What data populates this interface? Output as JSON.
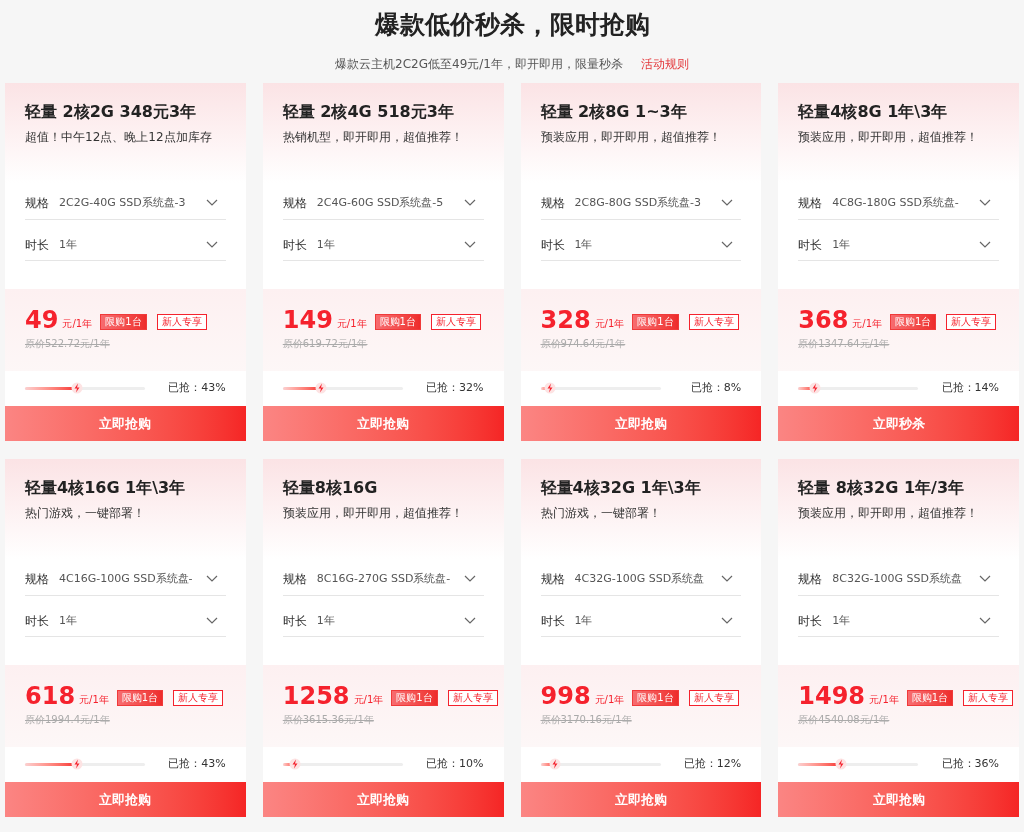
{
  "header": {
    "title": "爆款低价秒杀，限时抢购",
    "subtitle": "爆款云主机2C2G低至49元/1年，即开即用，限量秒杀",
    "rules_link": "活动规则"
  },
  "cards": [
    {
      "title": "轻量 2核2G 348元3年",
      "subtitle": "超值！中午12点、晚上12点加库存",
      "spec_label": "规格",
      "spec_value": "2C2G-40G SSD系统盘-3",
      "duration_label": "时长",
      "duration_value": "1年",
      "price": "49",
      "unit": "元/1年",
      "badges": [
        {
          "text": "限购1台",
          "kind": "solid"
        },
        {
          "text": "新人专享",
          "kind": "outline"
        }
      ],
      "original_price": "原价522.72元/1年",
      "level": 0.43,
      "sold": "已抢：43%",
      "button": "立即抢购"
    },
    {
      "title": "轻量 2核4G 518元3年",
      "subtitle": "热销机型，即开即用，超值推荐！",
      "spec_label": "规格",
      "spec_value": "2C4G-60G SSD系统盘-5",
      "duration_label": "时长",
      "duration_value": "1年",
      "price": "149",
      "unit": "元/1年",
      "badges": [
        {
          "text": "限购1台",
          "kind": "solid"
        },
        {
          "text": "新人专享",
          "kind": "outline"
        }
      ],
      "original_price": "原价619.72元/1年",
      "level": 0.32,
      "sold": "已抢：32%",
      "button": "立即抢购"
    },
    {
      "title": "轻量 2核8G 1~3年",
      "subtitle": "预装应用，即开即用，超值推荐！",
      "spec_label": "规格",
      "spec_value": "2C8G-80G SSD系统盘-3",
      "duration_label": "时长",
      "duration_value": "1年",
      "price": "328",
      "unit": "元/1年",
      "badges": [
        {
          "text": "限购1台",
          "kind": "solid"
        },
        {
          "text": "新人专享",
          "kind": "outline"
        }
      ],
      "original_price": "原价974.64元/1年",
      "level": 0.08,
      "sold": "已抢：8%",
      "button": "立即抢购"
    },
    {
      "title": "轻量4核8G 1年\\3年",
      "subtitle": "预装应用，即开即用，超值推荐！",
      "spec_label": "规格",
      "spec_value": "4C8G-180G SSD系统盘-",
      "duration_label": "时长",
      "duration_value": "1年",
      "price": "368",
      "unit": "元/1年",
      "badges": [
        {
          "text": "限购1台",
          "kind": "solid"
        },
        {
          "text": "新人专享",
          "kind": "outline"
        }
      ],
      "original_price": "原价1347.64元/1年",
      "level": 0.14,
      "sold": "已抢：14%",
      "button": "立即秒杀"
    },
    {
      "title": "轻量4核16G 1年\\3年",
      "subtitle": "热门游戏，一键部署！",
      "spec_label": "规格",
      "spec_value": "4C16G-100G SSD系统盘-",
      "duration_label": "时长",
      "duration_value": "1年",
      "price": "618",
      "unit": "元/1年",
      "badges": [
        {
          "text": "限购1台",
          "kind": "solid"
        },
        {
          "text": "新人专享",
          "kind": "outline"
        }
      ],
      "original_price": "原价1994.4元/1年",
      "level": 0.43,
      "sold": "已抢：43%",
      "button": "立即抢购"
    },
    {
      "title": "轻量8核16G",
      "subtitle": "预装应用，即开即用，超值推荐！",
      "spec_label": "规格",
      "spec_value": "8C16G-270G SSD系统盘-",
      "duration_label": "时长",
      "duration_value": "1年",
      "price": "1258",
      "unit": "元/1年",
      "badges": [
        {
          "text": "限购1台",
          "kind": "solid"
        },
        {
          "text": "新人专享",
          "kind": "outline"
        }
      ],
      "original_price": "原价3615.36元/1年",
      "level": 0.1,
      "sold": "已抢：10%",
      "button": "立即抢购"
    },
    {
      "title": "轻量4核32G 1年\\3年",
      "subtitle": "热门游戏，一键部署！",
      "spec_label": "规格",
      "spec_value": "4C32G-100G SSD系统盘",
      "duration_label": "时长",
      "duration_value": "1年",
      "price": "998",
      "unit": "元/1年",
      "badges": [
        {
          "text": "限购1台",
          "kind": "solid"
        },
        {
          "text": "新人专享",
          "kind": "outline"
        }
      ],
      "original_price": "原价3170.16元/1年",
      "level": 0.12,
      "sold": "已抢：12%",
      "button": "立即抢购"
    },
    {
      "title": "轻量 8核32G 1年/3年",
      "subtitle": "预装应用，即开即用，超值推荐！",
      "spec_label": "规格",
      "spec_value": "8C32G-100G SSD系统盘",
      "duration_label": "时长",
      "duration_value": "1年",
      "price": "1498",
      "unit": "元/1年",
      "badges": [
        {
          "text": "限购1台",
          "kind": "solid"
        },
        {
          "text": "新人专享",
          "kind": "outline"
        }
      ],
      "original_price": "原价4540.08元/1年",
      "level": 0.36,
      "sold": "已抢：36%",
      "button": "立即抢购"
    }
  ]
}
